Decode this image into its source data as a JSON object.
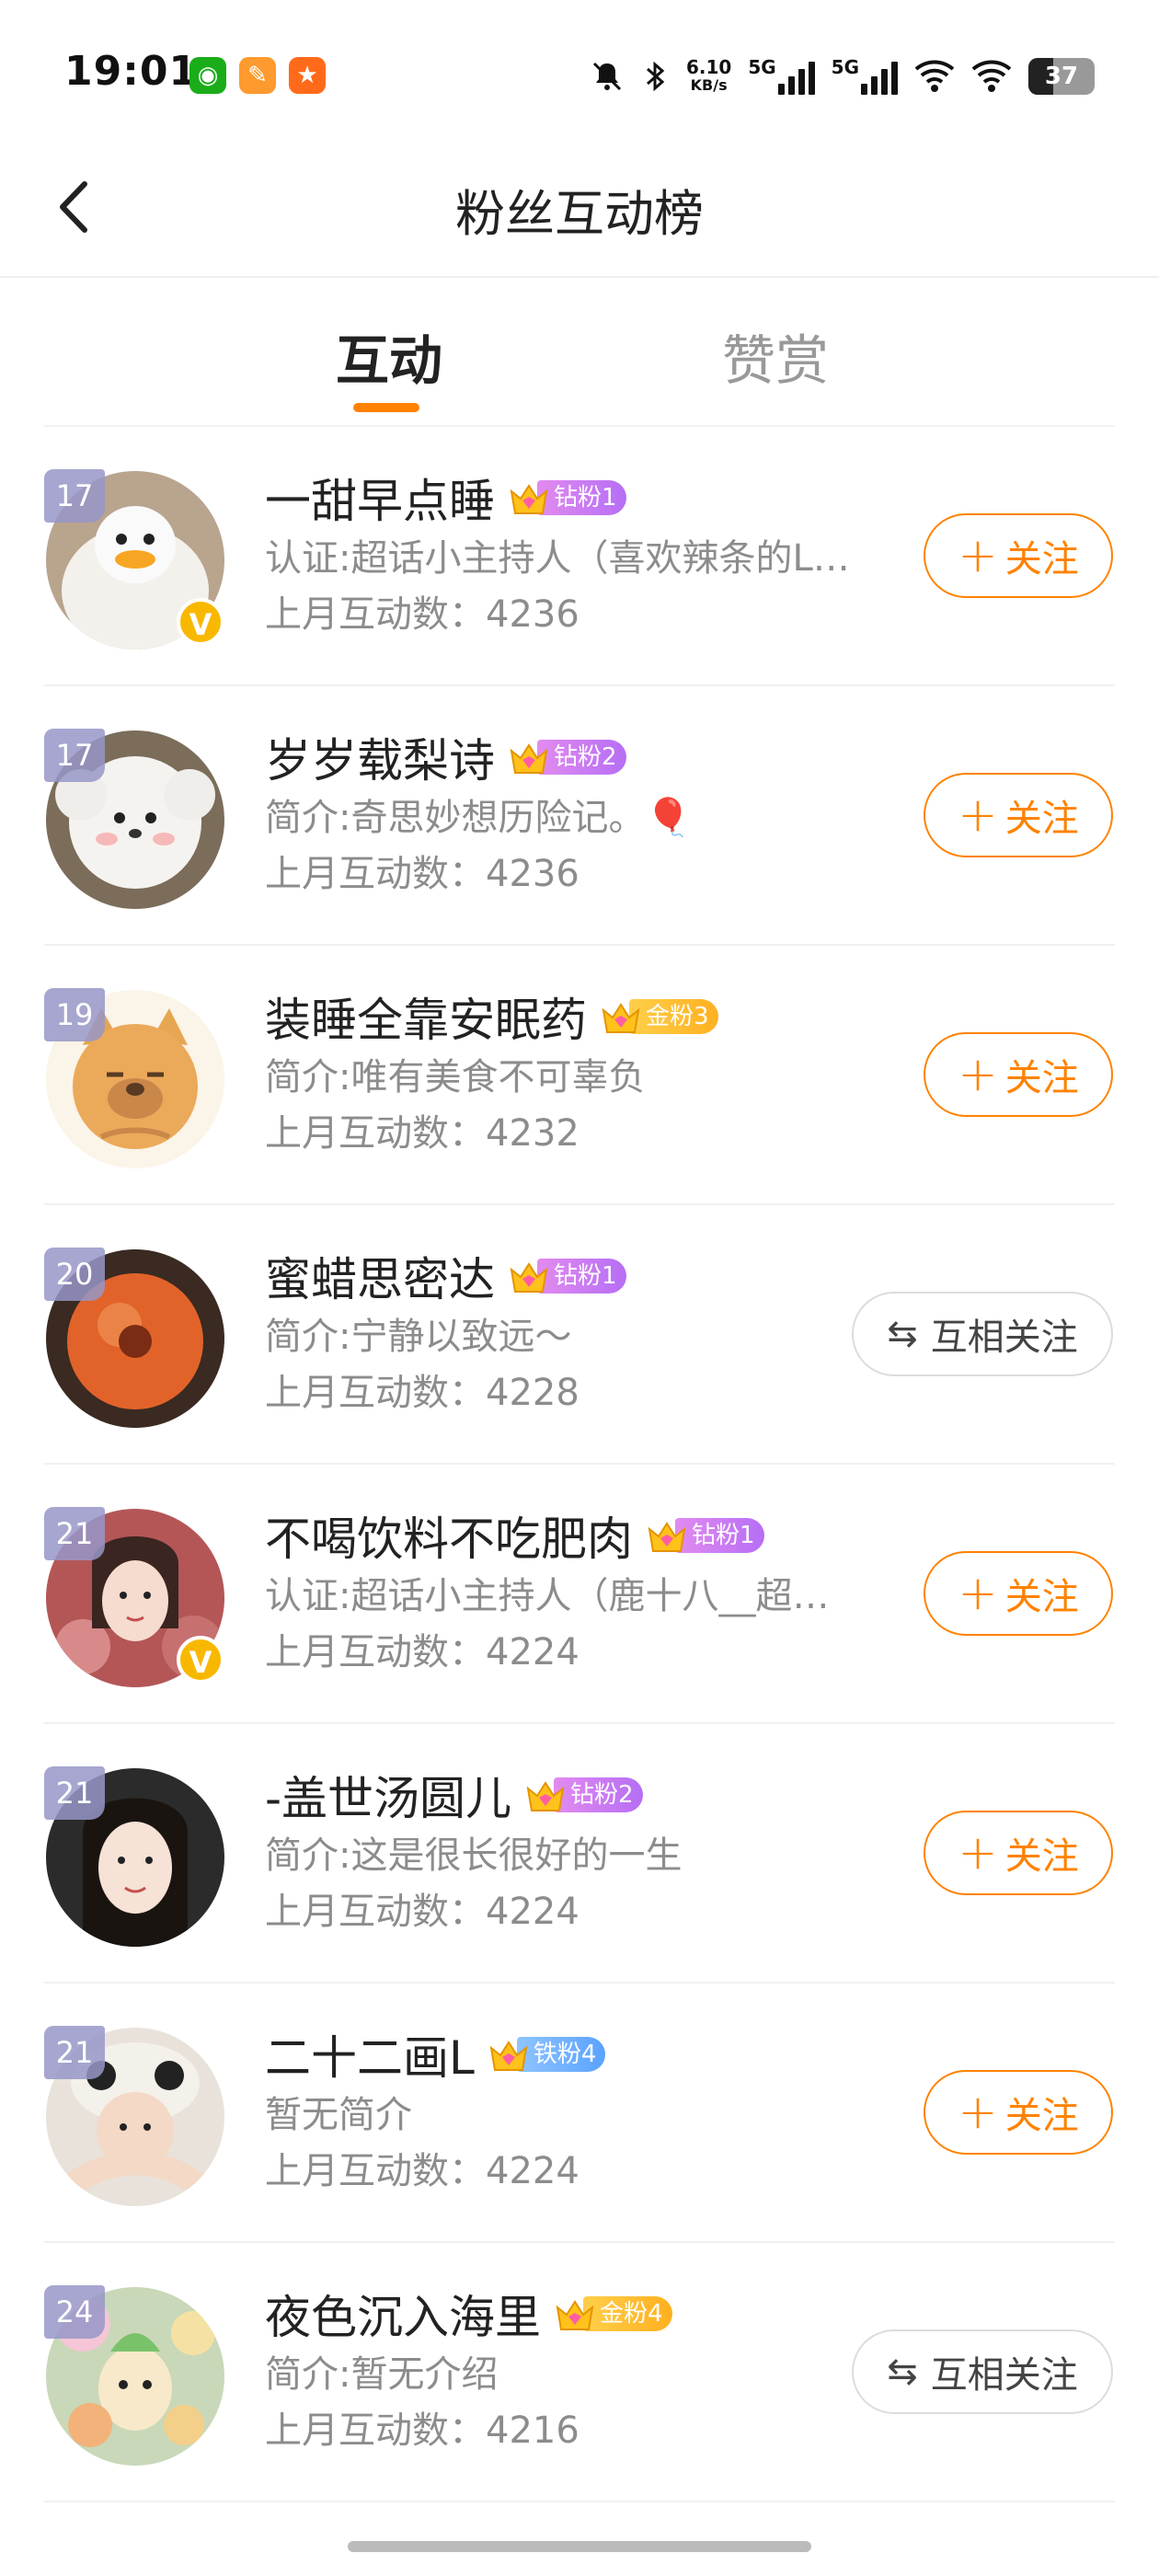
{
  "status_bar": {
    "time": "19:01",
    "net_speed_value": "6.10",
    "net_speed_unit": "KB/s",
    "net1": "5G",
    "net2": "5G",
    "battery": "37"
  },
  "header": {
    "title": "粉丝互动榜"
  },
  "tabs": [
    {
      "label": "互动"
    },
    {
      "label": "赞赏"
    }
  ],
  "users": [
    {
      "rank": "17",
      "name": "一甜早点睡",
      "badge": "钻粉1",
      "desc": "认证:超话小主持人（喜欢辣条的L…",
      "count": "上月互动数：4236",
      "action": "关注",
      "verified": true
    },
    {
      "rank": "17",
      "name": "岁岁载梨诗",
      "badge": "钻粉2",
      "desc": "简介:奇思妙想历险记。🎈",
      "count": "上月互动数：4236",
      "action": "关注",
      "verified": false
    },
    {
      "rank": "19",
      "name": "装睡全靠安眠药",
      "badge": "金粉3",
      "desc": "简介:唯有美食不可辜负",
      "count": "上月互动数：4232",
      "action": "关注",
      "verified": false
    },
    {
      "rank": "20",
      "name": "蜜蜡思密达",
      "badge": "钻粉1",
      "desc": "简介:宁静以致远～",
      "count": "上月互动数：4228",
      "action": "互相关注",
      "verified": false
    },
    {
      "rank": "21",
      "name": "不喝饮料不吃肥肉",
      "badge": "钻粉1",
      "desc": "认证:超话小主持人（鹿十八__超…",
      "count": "上月互动数：4224",
      "action": "关注",
      "verified": true
    },
    {
      "rank": "21",
      "name": "-盖世汤圆儿",
      "badge": "钻粉2",
      "desc": "简介:这是很长很好的一生",
      "count": "上月互动数：4224",
      "action": "关注",
      "verified": false
    },
    {
      "rank": "21",
      "name": "二十二画L",
      "badge": "铁粉4",
      "desc": "暂无简介",
      "count": "上月互动数：4224",
      "action": "关注",
      "verified": false
    },
    {
      "rank": "24",
      "name": "夜色沉入海里",
      "badge": "金粉4",
      "desc": "简介:暂无介绍",
      "count": "上月互动数：4216",
      "action": "互相关注",
      "verified": false
    }
  ],
  "verified_mark": "V",
  "colors": {
    "accent": "#ff8200",
    "badge_purple": "#c07af3",
    "badge_gold": "#ffbf2e",
    "badge_blue": "#6eb0ff"
  }
}
